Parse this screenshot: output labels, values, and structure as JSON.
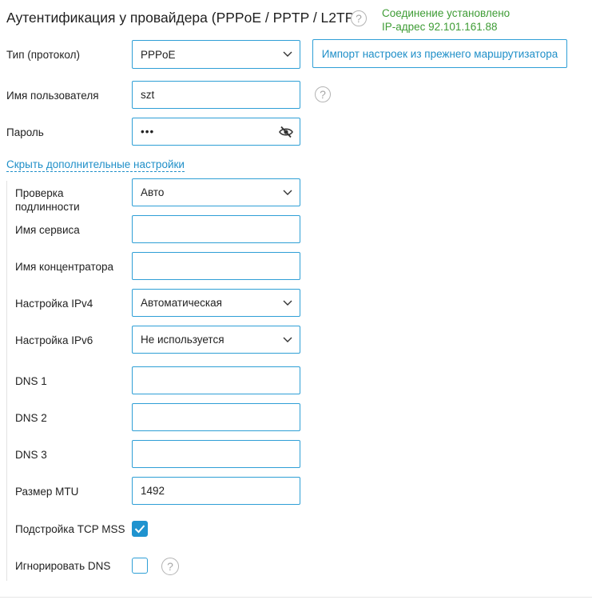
{
  "header": {
    "title": "Аутентификация у провайдера (PPPoE / PPTP / L2TP)",
    "help_glyph": "?",
    "status_line1": "Соединение установлено",
    "status_line2": "IP-адрес 92.101.161.88",
    "status_color": "#3e9c35"
  },
  "fields": {
    "protocol_label": "Тип (протокол)",
    "protocol_value": "PPPoE",
    "import_button": "Импорт настроек из прежнего маршрутизатора",
    "username_label": "Имя пользователя",
    "username_value": "szt",
    "password_label": "Пароль",
    "password_value": "•••"
  },
  "advanced_toggle": "Скрыть дополнительные настройки",
  "advanced": {
    "auth_label": "Проверка подлинности",
    "auth_value": "Авто",
    "service_label": "Имя сервиса",
    "service_value": "",
    "concentrator_label": "Имя концентратора",
    "concentrator_value": "",
    "ipv4_label": "Настройка IPv4",
    "ipv4_value": "Автоматическая",
    "ipv6_label": "Настройка IPv6",
    "ipv6_value": "Не используется",
    "dns1_label": "DNS 1",
    "dns1_value": "",
    "dns2_label": "DNS 2",
    "dns2_value": "",
    "dns3_label": "DNS 3",
    "dns3_value": "",
    "mtu_label": "Размер MTU",
    "mtu_value": "1492",
    "tcp_mss_label": "Подстройка TCP MSS",
    "tcp_mss_checked": true,
    "ignore_dns_label": "Игнорировать DNS",
    "ignore_dns_checked": false
  },
  "colors": {
    "accent": "#2f9fd6",
    "link": "#1f8fc8",
    "checkbox_fill": "#1f93cf"
  },
  "icons": {
    "help": "question-circle",
    "chevron": "chevron-down",
    "password_toggle": "eye-slash",
    "check": "checkmark"
  }
}
